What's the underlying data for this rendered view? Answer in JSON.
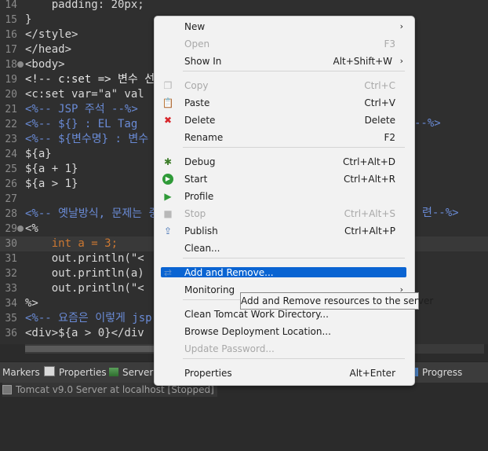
{
  "editor": {
    "lines": [
      {
        "num": "14",
        "text": "    padding: 20px;"
      },
      {
        "num": "15",
        "text": "}"
      },
      {
        "num": "16",
        "text": "</style>"
      },
      {
        "num": "17",
        "text": "</head>"
      },
      {
        "num": "18",
        "text": "<body>"
      },
      {
        "num": "19",
        "text": "<!-- c:set => 변수 선"
      },
      {
        "num": "20",
        "text": "<c:set var=\"a\" val"
      },
      {
        "num": "21",
        "text": "<%-- JSP 주석 --%>"
      },
      {
        "num": "22",
        "text": "<%-- ${} : EL Tag"
      },
      {
        "num": "23",
        "text": "<%-- ${변수명} : 변수"
      },
      {
        "num": "24",
        "text": "${a}"
      },
      {
        "num": "25",
        "text": "${a + 1}"
      },
      {
        "num": "26",
        "text": "${a > 1}"
      },
      {
        "num": "27",
        "text": ""
      },
      {
        "num": "28",
        "text": "<%-- 옛날방식, 문제는 중"
      },
      {
        "num": "29",
        "text": "<%"
      },
      {
        "num": "30",
        "text": "    int a = 3;"
      },
      {
        "num": "31",
        "text": "    out.println(\"<"
      },
      {
        "num": "32",
        "text": "    out.println(a)"
      },
      {
        "num": "33",
        "text": "    out.println(\"<"
      },
      {
        "num": "34",
        "text": "%>"
      },
      {
        "num": "35",
        "text": "<%-- 요즘은 이렇게 jsp"
      },
      {
        "num": "36",
        "text": "<div>${a > 0}</div"
      }
    ],
    "right_fragment_22": "--%>",
    "right_fragment_28": "련--%>"
  },
  "panel": {
    "tabs": [
      {
        "label": "Markers",
        "icon": "markers-icon"
      },
      {
        "label": "Properties",
        "icon": "properties-icon"
      },
      {
        "label": "Servers",
        "icon": "servers-icon"
      },
      {
        "label": "Progress",
        "icon": "progress-icon"
      }
    ],
    "server_entry": "Tomcat v9.0 Server at localhost  [Stopped]"
  },
  "context_menu": {
    "items": [
      {
        "label": "New",
        "shortcut": "",
        "submenu": true,
        "disabled": false,
        "icon": ""
      },
      {
        "label": "Open",
        "shortcut": "F3",
        "submenu": false,
        "disabled": true,
        "icon": ""
      },
      {
        "label": "Show In",
        "shortcut": "Alt+Shift+W",
        "submenu": true,
        "disabled": false,
        "icon": ""
      },
      {
        "label": "Copy",
        "shortcut": "Ctrl+C",
        "submenu": false,
        "disabled": true,
        "icon": "copy-icon"
      },
      {
        "label": "Paste",
        "shortcut": "Ctrl+V",
        "submenu": false,
        "disabled": false,
        "icon": "paste-icon"
      },
      {
        "label": "Delete",
        "shortcut": "Delete",
        "submenu": false,
        "disabled": false,
        "icon": "delete-icon"
      },
      {
        "label": "Rename",
        "shortcut": "F2",
        "submenu": false,
        "disabled": false,
        "icon": ""
      },
      {
        "label": "Debug",
        "shortcut": "Ctrl+Alt+D",
        "submenu": false,
        "disabled": false,
        "icon": "debug-icon"
      },
      {
        "label": "Start",
        "shortcut": "Ctrl+Alt+R",
        "submenu": false,
        "disabled": false,
        "icon": "start-icon"
      },
      {
        "label": "Profile",
        "shortcut": "",
        "submenu": false,
        "disabled": false,
        "icon": "profile-icon"
      },
      {
        "label": "Stop",
        "shortcut": "Ctrl+Alt+S",
        "submenu": false,
        "disabled": true,
        "icon": "stop-icon"
      },
      {
        "label": "Publish",
        "shortcut": "Ctrl+Alt+P",
        "submenu": false,
        "disabled": false,
        "icon": "publish-icon"
      },
      {
        "label": "Clean...",
        "shortcut": "",
        "submenu": false,
        "disabled": false,
        "icon": ""
      },
      {
        "label": "Add and Remove...",
        "shortcut": "",
        "submenu": false,
        "disabled": false,
        "icon": "add-remove-icon",
        "selected": true
      },
      {
        "label": "Monitoring",
        "shortcut": "",
        "submenu": true,
        "disabled": false,
        "icon": ""
      },
      {
        "label": "Clean Tomcat Work Directory...",
        "shortcut": "",
        "submenu": false,
        "disabled": false,
        "icon": ""
      },
      {
        "label": "Browse Deployment Location...",
        "shortcut": "",
        "submenu": false,
        "disabled": false,
        "icon": ""
      },
      {
        "label": "Update Password...",
        "shortcut": "",
        "submenu": false,
        "disabled": true,
        "icon": ""
      },
      {
        "label": "Properties",
        "shortcut": "Alt+Enter",
        "submenu": false,
        "disabled": false,
        "icon": ""
      }
    ],
    "tooltip": "Add and Remove resources to the server"
  },
  "colors": {
    "selection": "#0a64d2",
    "editor_bg": "#2f2f2f",
    "comment": "#6a8bd6",
    "keyword": "#cc7832"
  }
}
